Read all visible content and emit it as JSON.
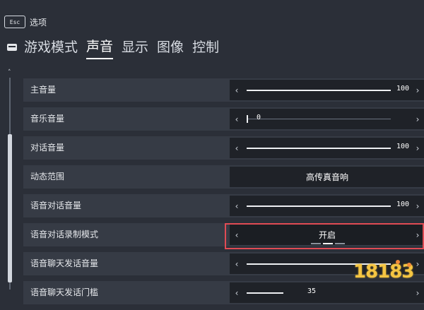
{
  "header": {
    "esc_key": "Esc",
    "title": "选项"
  },
  "tabs": [
    {
      "label": "游戏模式",
      "active": false
    },
    {
      "label": "声音",
      "active": true
    },
    {
      "label": "显示",
      "active": false
    },
    {
      "label": "图像",
      "active": false
    },
    {
      "label": "控制",
      "active": false
    }
  ],
  "settings": [
    {
      "label": "主音量",
      "type": "slider",
      "value": "100"
    },
    {
      "label": "音乐音量",
      "type": "slider",
      "value": "0"
    },
    {
      "label": "对话音量",
      "type": "slider",
      "value": "100"
    },
    {
      "label": "动态范围",
      "type": "choice",
      "value": "高传真音响"
    },
    {
      "label": "语音对话音量",
      "type": "slider",
      "value": "100"
    },
    {
      "label": "语音对话录制模式",
      "type": "choice",
      "value": "开启",
      "selected": true
    },
    {
      "label": "语音聊天发话音量",
      "type": "slider",
      "value": ""
    },
    {
      "label": "语音聊天发话门槛",
      "type": "slider",
      "value": "35"
    }
  ],
  "colors": {
    "background": "#2b2f38",
    "row": "#363b45",
    "control": "#1f2228",
    "highlight": "#e04b54"
  },
  "watermark": "18183"
}
